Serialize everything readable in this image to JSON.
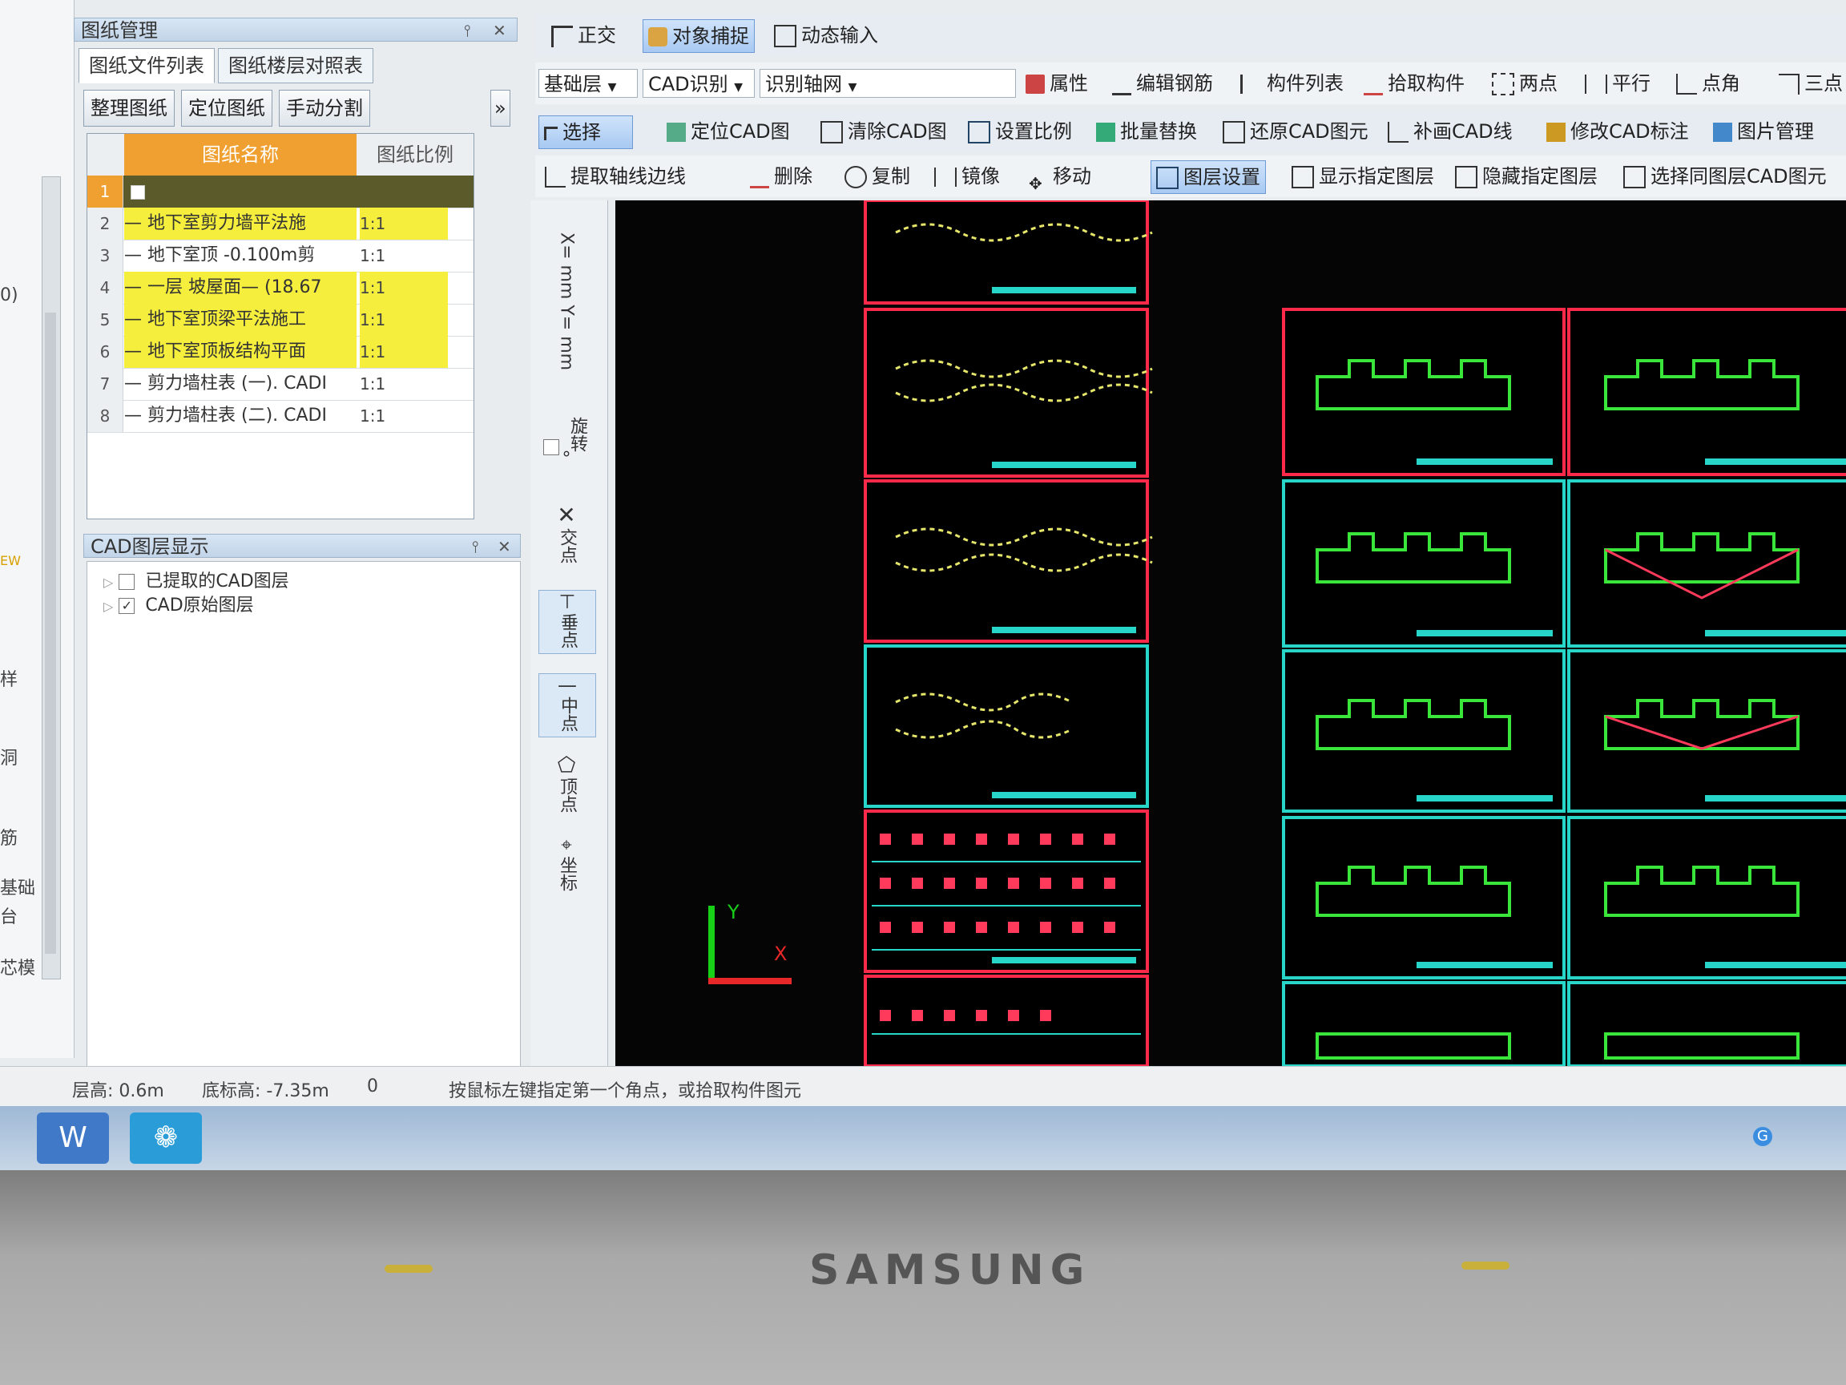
{
  "drawing_panel": {
    "title": "图纸管理",
    "tabs": [
      "图纸文件列表",
      "图纸楼层对照表"
    ],
    "buttons": [
      "整理图纸",
      "定位图纸",
      "手动分割"
    ],
    "columns": [
      "图纸名称",
      "图纸比例"
    ],
    "rows": [
      {
        "num": "1",
        "name": "",
        "ratio": "",
        "highlight": "header"
      },
      {
        "num": "2",
        "name": "— 地下室剪力墙平法施",
        "ratio": "1:1",
        "highlight": "yellow"
      },
      {
        "num": "3",
        "name": "— 地下室顶 -0.100m剪",
        "ratio": "1:1",
        "highlight": ""
      },
      {
        "num": "4",
        "name": "— 一层 坡屋面— (18.67",
        "ratio": "1:1",
        "highlight": "yellow"
      },
      {
        "num": "5",
        "name": "— 地下室顶梁平法施工",
        "ratio": "1:1",
        "highlight": "yellow"
      },
      {
        "num": "6",
        "name": "— 地下室顶板结构平面",
        "ratio": "1:1",
        "highlight": "yellow"
      },
      {
        "num": "7",
        "name": "— 剪力墙柱表 (一). CADI",
        "ratio": "1:1",
        "highlight": ""
      },
      {
        "num": "8",
        "name": "— 剪力墙柱表 (二). CADI",
        "ratio": "1:1",
        "highlight": ""
      }
    ]
  },
  "layer_panel": {
    "title": "CAD图层显示",
    "items": [
      {
        "label": "已提取的CAD图层",
        "checked": false
      },
      {
        "label": "CAD原始图层",
        "checked": true
      }
    ]
  },
  "left_edge_labels": [
    "0)",
    "EW",
    "样",
    "洞",
    "筋",
    "基础",
    "台",
    "芯模"
  ],
  "toolbar_top": {
    "items": [
      "正交",
      "对象捕捉",
      "动态输入"
    ]
  },
  "toolbar_row2": {
    "floor": "基础层",
    "mode": "CAD识别",
    "type": "识别轴网",
    "items": [
      "属性",
      "编辑钢筋",
      "构件列表",
      "拾取构件",
      "两点",
      "平行",
      "点角",
      "三点"
    ]
  },
  "toolbar_row3": {
    "select": "选择",
    "items": [
      "定位CAD图",
      "清除CAD图",
      "设置比例",
      "批量替换",
      "还原CAD图元",
      "补画CAD线",
      "修改CAD标注",
      "图片管理"
    ]
  },
  "toolbar_row4": {
    "items": [
      "提取轴线边线",
      "删除",
      "复制",
      "镜像",
      "移动",
      "图层设置",
      "显示指定图层",
      "隐藏指定图层",
      "选择同图层CAD图元"
    ]
  },
  "snap_panel": {
    "coord": "X= mm Y= mm",
    "rotate": "旋转",
    "degree": "°",
    "snaps": [
      "交点",
      "垂点",
      "中点",
      "顶点",
      "坐标"
    ]
  },
  "canvas": {
    "axis_y": "Y",
    "axis_x": "X"
  },
  "status_bar": {
    "floor_height": "层高: 0.6m",
    "base_elev": "底标高: -7.35m",
    "zero": "0",
    "hint": "按鼠标左键指定第一个角点，或拾取构件图元"
  },
  "bezel": {
    "brand": "SAMSUNG"
  },
  "colors": {
    "accent_yellow": "#f6ee3c",
    "header_orange": "#f0a030",
    "canvas_bg": "#050505",
    "sheet_red": "#ff2a4a",
    "sheet_cyan": "#27d6c8"
  }
}
